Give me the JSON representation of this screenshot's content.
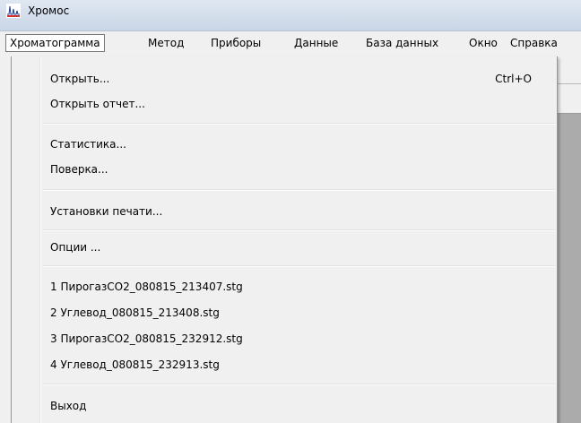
{
  "window": {
    "title": "Хромос"
  },
  "menubar": {
    "items": [
      {
        "label": "Хроматограмма"
      },
      {
        "label": "Метод"
      },
      {
        "label": "Приборы"
      },
      {
        "label": "Данные"
      },
      {
        "label": "База данных"
      },
      {
        "label": "Окно"
      },
      {
        "label": "Справка"
      }
    ]
  },
  "dropdown": {
    "items": [
      {
        "label": "Открыть...",
        "shortcut": "Ctrl+O"
      },
      {
        "label": "Открыть отчет..."
      },
      {
        "label": "Статистика..."
      },
      {
        "label": "Поверка..."
      },
      {
        "label": "Установки печати..."
      },
      {
        "label": "Опции ..."
      },
      {
        "label": "1 ПирогазCO2_080815_213407.stg"
      },
      {
        "label": "2 Углевод_080815_213408.stg"
      },
      {
        "label": "3 ПирогазCO2_080815_232912.stg"
      },
      {
        "label": "4 Углевод_080815_232913.stg"
      },
      {
        "label": "Выход"
      }
    ]
  },
  "colors": {
    "titlebar": "#c9d6e6",
    "menu_bg": "#f0f0f0",
    "mdi_background": "#ababab"
  },
  "icons": {
    "app": "chromatogram-app-icon"
  }
}
